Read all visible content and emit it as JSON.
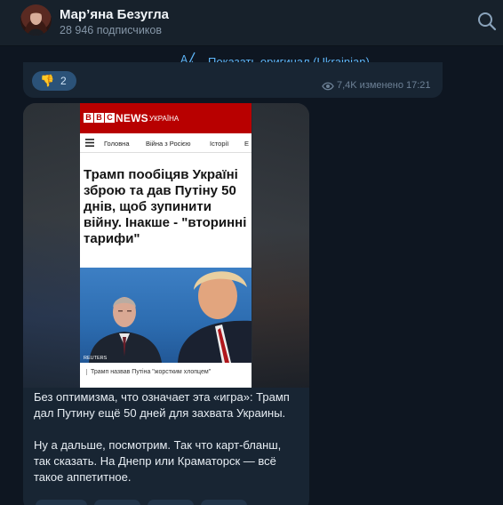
{
  "header": {
    "channel_name": "Мар’яна Безугла",
    "subscribers": "28 946 подписчиков"
  },
  "translate": {
    "label": "Показать оригинал (Ukrainian)"
  },
  "prev_message": {
    "reaction_emoji": "👎",
    "reaction_count": "2",
    "meta": "7,4K изменено 17:21"
  },
  "article": {
    "logo_letters": [
      "B",
      "B",
      "C"
    ],
    "brand": "NEWS",
    "edition": "УКРАЇНА",
    "nav": [
      "Головна",
      "Війна з Росією",
      "Історії",
      "E"
    ],
    "headline": "Трамп пообіцяв Україні зброю та дав Путіну 50 днів, щоб зупинити війну. Інакше - \"вторинні тарифи\"",
    "photo_credit": "REUTERS",
    "caption": "Трамп назвав Путіна \"жорстким хлопцем\""
  },
  "post": {
    "paragraphs": [
      "Без оптимизма, что означает эта «игра»: Трамп дал Путину ещё 50 дней для захвата Украины.",
      "Ну а дальше, посмотрим. Так что карт-бланш, так сказать. На Днепр или Краматорск — всё такое аппетитное."
    ]
  },
  "colors": {
    "background": "#0e1621",
    "header": "#17212b",
    "bubble": "#182533",
    "accent": "#5eb5f7",
    "bbc_red": "#b80000"
  }
}
